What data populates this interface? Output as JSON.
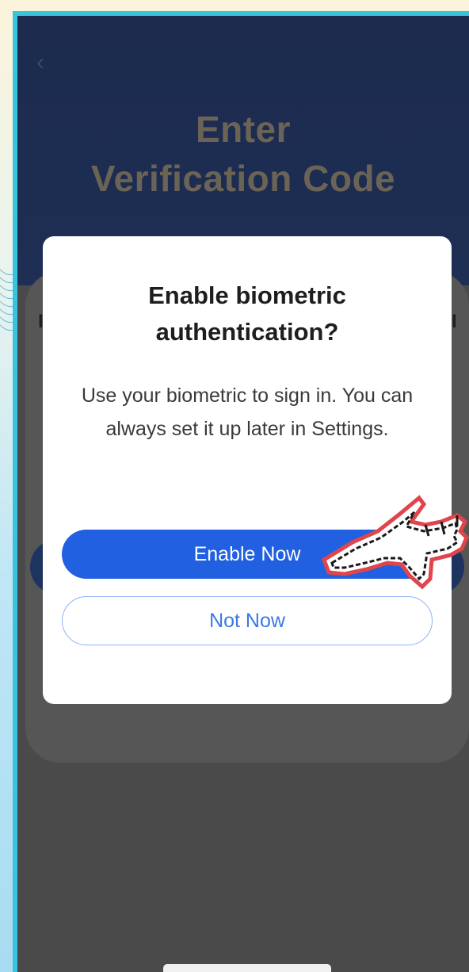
{
  "screen": {
    "back_icon": "chevron-left-icon",
    "title_line1": "Enter",
    "title_line2": "Verification Code",
    "background_left_letter": "I",
    "background_right_letter": "I"
  },
  "dialog": {
    "title": "Enable biometric authentication?",
    "message": "Use your biometric to sign in. You can always set it up later in Settings.",
    "primary_button": "Enable Now",
    "secondary_button": "Not Now"
  },
  "colors": {
    "primary": "#2160e0",
    "secondary_text": "#3b78e6",
    "header_bg": "#1c2b4e",
    "overlay": "#4a4a4a",
    "frame_accent": "#38c4dc"
  },
  "pointer_icon": "pixel-hand-pointer-icon"
}
